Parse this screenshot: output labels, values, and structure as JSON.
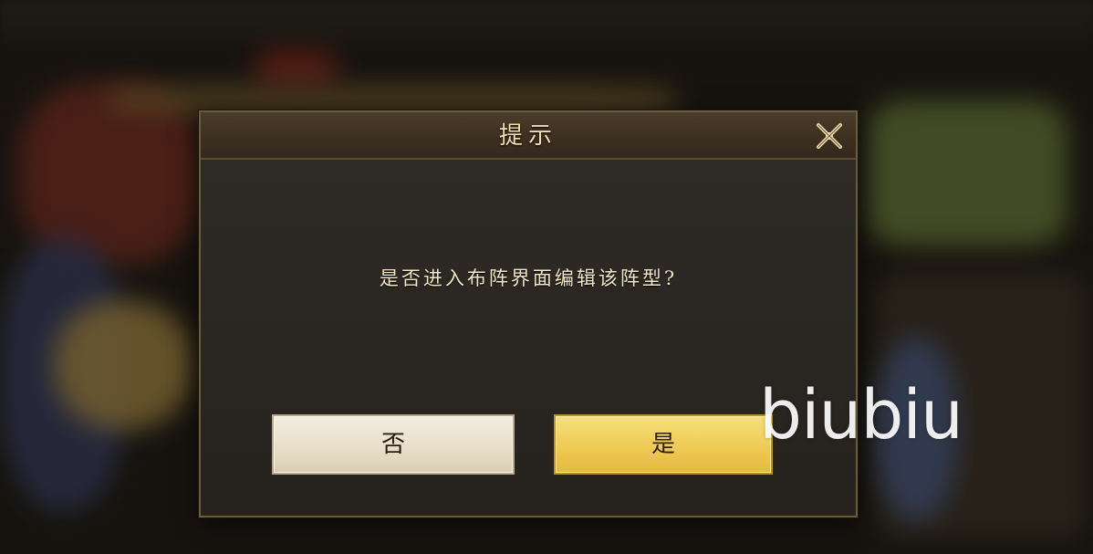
{
  "dialog": {
    "title": "提示",
    "message": "是否进入布阵界面编辑该阵型?",
    "no_label": "否",
    "yes_label": "是",
    "close_icon": "close-x-icon"
  },
  "watermark": {
    "text": "biubiu"
  },
  "colors": {
    "title_text": "#f1dcae",
    "message_text": "#f3e6c8",
    "yes_button": "#efcb55",
    "no_button": "#e7ddc8",
    "dialog_bg": "#2a2722",
    "dialog_border": "#6b5a3c"
  }
}
